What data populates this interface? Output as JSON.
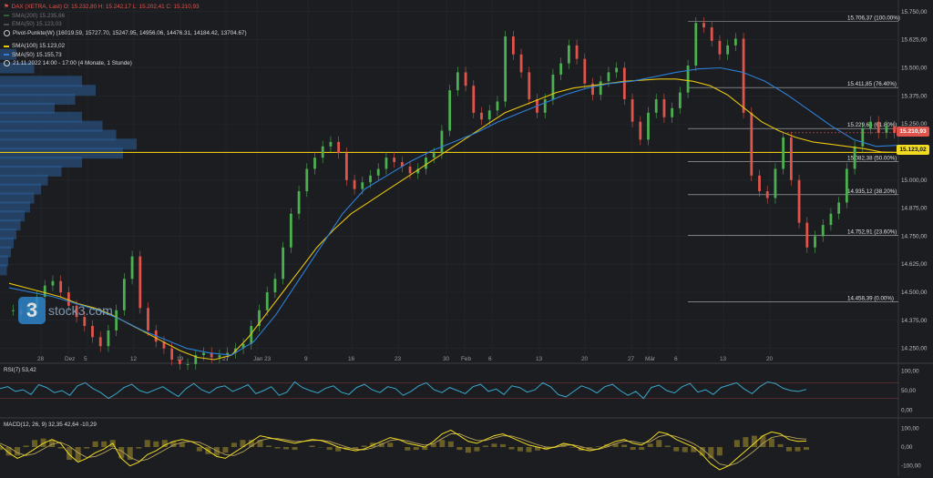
{
  "legend": {
    "main": "DAX (XETRA, Last)  O: 15.232,80  H: 15.242,17  L: 15.202,41  C: 15.210,93",
    "sma200_label": "SMA(200)  15.235,66",
    "sma50_label": "EMA(50)  15.123,03",
    "pivot": "Pivot-Punkte(W)  (16019.59,  15727.70,  15247.95,  14956.06,  14476.31,  14184.42,  13704.67)",
    "sma100": "SMA(100)  15.123,02",
    "sma100_blue": "SMA(50)  15.155,73",
    "range": "21.11.2022 14:00 - 17:00  (4 Monate, 1 Stunde)"
  },
  "price_tags": {
    "last": "15.210,93",
    "sma": "15.123,02"
  },
  "watermark": {
    "logo": "3",
    "text": "stock3.com"
  },
  "rsi_label": "RSI(7)  53,42",
  "macd_label": "MACD(12, 26, 9)  32,35  42,64  -10,29",
  "colors": {
    "bg": "#1b1d21",
    "up": "#4caf50",
    "down": "#e0544b",
    "sma": "#e8c60f",
    "blue": "#2e7fd6",
    "rsi": "#3aa7c9",
    "fib": "#dcdcdc",
    "last_tag": "#e0544b",
    "sma_tag": "#f2dc1f"
  },
  "chart_data": {
    "type": "line",
    "title": "DAX (XETRA, Last)",
    "y_axis_ticks": [
      "15.750,00",
      "15.625,00",
      "15.500,00",
      "15.375,00",
      "15.250,00",
      "15.125,00",
      "15.000,00",
      "14.875,00",
      "14.750,00",
      "14.625,00",
      "14.500,00",
      "14.375,00",
      "14.250,00"
    ],
    "ylim": [
      14200,
      15790
    ],
    "x_axis_ticks": [
      "28",
      "Dez",
      "5",
      "12",
      "19",
      "27",
      "Jan 23",
      "9",
      "16",
      "23",
      "30",
      "Feb",
      "6",
      "13",
      "20",
      "27",
      "Mär",
      "6",
      "13",
      "20"
    ],
    "fibonacci": [
      {
        "value": 15706.37,
        "label": "15.706,37 (100.00%)"
      },
      {
        "value": 15411.85,
        "label": "15.411,85 (76.40%)"
      },
      {
        "value": 15229.64,
        "label": "15.229,64 (61.80%)"
      },
      {
        "value": 15082.38,
        "label": "15.082,38 (50.00%)"
      },
      {
        "value": 14935.12,
        "label": "14.935,12 (38.20%)"
      },
      {
        "value": 14752.91,
        "label": "14.752,91 (23.60%)"
      },
      {
        "value": 14458.39,
        "label": "14.458,39 (0.00%)"
      }
    ],
    "close_series": [
      14420,
      14400,
      14430,
      14480,
      14530,
      14550,
      14500,
      14440,
      14390,
      14350,
      14300,
      14260,
      14330,
      14420,
      14560,
      14660,
      14430,
      14330,
      14280,
      14250,
      14200,
      14180,
      14180,
      14220,
      14230,
      14210,
      14220,
      14230,
      14250,
      14270,
      14350,
      14420,
      14500,
      14560,
      14700,
      14850,
      14950,
      15050,
      15100,
      15150,
      15170,
      15120,
      15000,
      14960,
      14990,
      15020,
      15050,
      15100,
      15080,
      15060,
      15030,
      15050,
      15100,
      15120,
      15220,
      15400,
      15480,
      15420,
      15300,
      15270,
      15310,
      15350,
      15640,
      15560,
      15480,
      15360,
      15300,
      15360,
      15470,
      15520,
      15600,
      15540,
      15430,
      15380,
      15440,
      15480,
      15500,
      15360,
      15260,
      15180,
      15300,
      15360,
      15280,
      15320,
      15390,
      15510,
      15700,
      15680,
      15620,
      15560,
      15600,
      15630,
      15300,
      15020,
      14950,
      14920,
      15050,
      15190,
      15000,
      14810,
      14700,
      14750,
      14800,
      14850,
      14900,
      15050,
      15150,
      15230,
      15260,
      15210,
      15240,
      15210
    ],
    "sma_100": [
      14540,
      14520,
      14500,
      14480,
      14450,
      14430,
      14400,
      14360,
      14320,
      14280,
      14240,
      14210,
      14200,
      14220,
      14300,
      14400,
      14500,
      14600,
      14700,
      14780,
      14850,
      14900,
      14950,
      15000,
      15050,
      15100,
      15150,
      15200,
      15250,
      15300,
      15330,
      15360,
      15390,
      15410,
      15420,
      15430,
      15440,
      15445,
      15450,
      15450,
      15440,
      15420,
      15380,
      15320,
      15260,
      15220,
      15190,
      15170,
      15160,
      15150,
      15140,
      15125,
      15123
    ],
    "sma_50": [
      14520,
      14500,
      14480,
      14450,
      14420,
      14380,
      14330,
      14290,
      14250,
      14230,
      14220,
      14280,
      14400,
      14550,
      14700,
      14850,
      14960,
      15020,
      15080,
      15130,
      15170,
      15210,
      15260,
      15300,
      15340,
      15380,
      15410,
      15430,
      15440,
      15460,
      15480,
      15495,
      15500,
      15480,
      15440,
      15380,
      15310,
      15240,
      15180,
      15150,
      15155
    ],
    "volume_profile": [
      {
        "price": 15560,
        "vol": 0.12
      },
      {
        "price": 15500,
        "vol": 0.25
      },
      {
        "price": 15440,
        "vol": 0.6
      },
      {
        "price": 15400,
        "vol": 0.7
      },
      {
        "price": 15360,
        "vol": 0.55
      },
      {
        "price": 15320,
        "vol": 0.4
      },
      {
        "price": 15280,
        "vol": 0.6
      },
      {
        "price": 15240,
        "vol": 0.75
      },
      {
        "price": 15200,
        "vol": 0.85
      },
      {
        "price": 15160,
        "vol": 1.0
      },
      {
        "price": 15120,
        "vol": 0.9
      },
      {
        "price": 15080,
        "vol": 0.6
      },
      {
        "price": 15040,
        "vol": 0.45
      },
      {
        "price": 15000,
        "vol": 0.35
      },
      {
        "price": 14960,
        "vol": 0.3
      },
      {
        "price": 14920,
        "vol": 0.25
      },
      {
        "price": 14880,
        "vol": 0.22
      },
      {
        "price": 14840,
        "vol": 0.18
      },
      {
        "price": 14800,
        "vol": 0.15
      },
      {
        "price": 14760,
        "vol": 0.12
      },
      {
        "price": 14720,
        "vol": 0.1
      },
      {
        "price": 14680,
        "vol": 0.08
      },
      {
        "price": 14640,
        "vol": 0.06
      },
      {
        "price": 14600,
        "vol": 0.05
      }
    ],
    "rsi": {
      "ylim": [
        -15,
        115
      ],
      "ticks": [
        "100,00",
        "50,00",
        "0,00"
      ],
      "levels": [
        70,
        30
      ],
      "values": [
        55,
        60,
        48,
        52,
        40,
        65,
        58,
        45,
        50,
        38,
        62,
        70,
        55,
        45,
        30,
        42,
        58,
        66,
        50,
        44,
        52,
        60,
        47,
        35,
        55,
        68,
        52,
        44,
        58,
        62,
        48,
        56,
        65,
        42,
        50,
        60,
        38,
        46,
        72,
        58,
        50,
        44,
        56,
        62,
        46,
        40,
        58,
        66,
        52,
        45,
        60,
        55,
        38,
        48,
        62,
        70,
        52,
        45,
        58,
        50,
        42,
        60,
        66,
        48,
        54,
        40,
        62,
        58,
        46,
        52,
        70,
        60,
        40,
        34,
        48,
        62,
        55,
        44,
        60,
        66,
        50,
        38,
        48,
        30,
        58,
        64,
        50,
        44,
        60,
        68,
        46,
        52,
        40,
        58,
        64,
        70,
        54,
        42,
        60,
        72,
        68,
        56,
        50,
        48,
        53
      ]
    },
    "macd": {
      "ylim": [
        -140,
        140
      ],
      "ticks": [
        "100,00",
        "0,00",
        "-100,00"
      ],
      "macd_line": [
        10,
        -30,
        -60,
        -40,
        -10,
        20,
        40,
        20,
        -40,
        -80,
        -60,
        -30,
        -10,
        20,
        -60,
        -100,
        -80,
        -40,
        -20,
        10,
        30,
        40,
        30,
        10,
        -20,
        -50,
        -60,
        -30,
        0,
        30,
        60,
        50,
        40,
        30,
        20,
        30,
        40,
        35,
        20,
        0,
        -10,
        -20,
        -10,
        10,
        30,
        50,
        40,
        20,
        10,
        0,
        30,
        70,
        90,
        60,
        30,
        20,
        40,
        60,
        70,
        50,
        30,
        10,
        0,
        -10,
        0,
        20,
        10,
        -10,
        -20,
        -10,
        10,
        30,
        40,
        20,
        10,
        40,
        80,
        70,
        40,
        20,
        0,
        -40,
        -90,
        -120,
        -100,
        -60,
        -20,
        20,
        60,
        80,
        70,
        40,
        30,
        32
      ],
      "signal_line": [
        20,
        0,
        -30,
        -45,
        -35,
        -10,
        15,
        25,
        5,
        -30,
        -55,
        -50,
        -30,
        -5,
        -20,
        -55,
        -75,
        -65,
        -40,
        -15,
        10,
        25,
        30,
        25,
        5,
        -20,
        -40,
        -45,
        -25,
        5,
        35,
        45,
        45,
        38,
        30,
        30,
        35,
        36,
        30,
        15,
        0,
        -12,
        -15,
        -5,
        15,
        35,
        40,
        32,
        20,
        10,
        18,
        45,
        70,
        70,
        50,
        35,
        35,
        48,
        60,
        58,
        45,
        28,
        12,
        0,
        -2,
        8,
        12,
        3,
        -10,
        -12,
        0,
        18,
        32,
        30,
        20,
        28,
        55,
        65,
        55,
        38,
        18,
        -10,
        -50,
        -90,
        -100,
        -85,
        -55,
        -20,
        20,
        50,
        60,
        55,
        45,
        42
      ]
    }
  }
}
